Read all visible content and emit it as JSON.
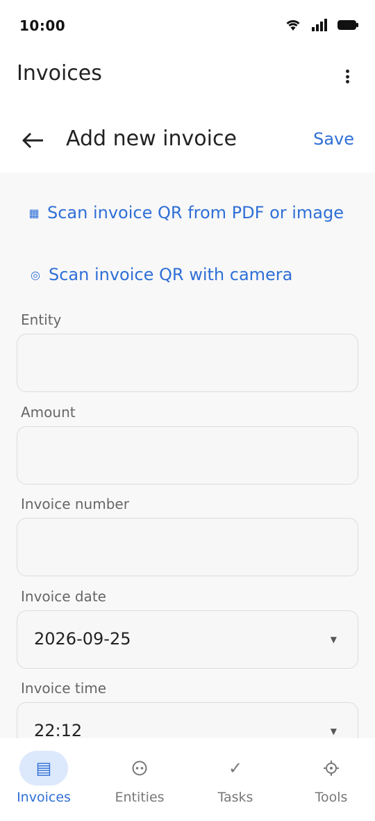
{
  "status": {
    "time": "10:00",
    "icons": [
      "wifi-icon",
      "signal-icon",
      "battery-icon"
    ]
  },
  "header": {
    "title": "Invoices",
    "menu_icon": "more-vert-icon"
  },
  "form": {
    "title": "Add new invoice",
    "save_label": "Save",
    "back_icon": "arrow-left-icon"
  },
  "scan": {
    "pdf_label": "Scan invoice QR from PDF or image",
    "pdf_icon": "grid-icon",
    "camera_label": "Scan invoice QR with camera",
    "camera_icon": "camera-icon"
  },
  "fields": {
    "entity": {
      "label": "Entity",
      "value": ""
    },
    "amount": {
      "label": "Amount",
      "value": ""
    },
    "invoice_number": {
      "label": "Invoice number",
      "value": ""
    },
    "invoice_date": {
      "label": "Invoice date",
      "value": "2026-09-25"
    },
    "invoice_time": {
      "label": "Invoice time",
      "value": "22:12"
    }
  },
  "nav": {
    "items": [
      {
        "label": "Invoices",
        "icon": "invoices-icon",
        "active": true
      },
      {
        "label": "Entities",
        "icon": "entities-icon",
        "active": false
      },
      {
        "label": "Tasks",
        "icon": "check-icon",
        "active": false
      },
      {
        "label": "Tools",
        "icon": "tools-icon",
        "active": false
      }
    ]
  },
  "colors": {
    "accent": "#2f6fd6",
    "nav_active_bg": "#dce8fb",
    "content_bg": "#f8f8f8"
  }
}
